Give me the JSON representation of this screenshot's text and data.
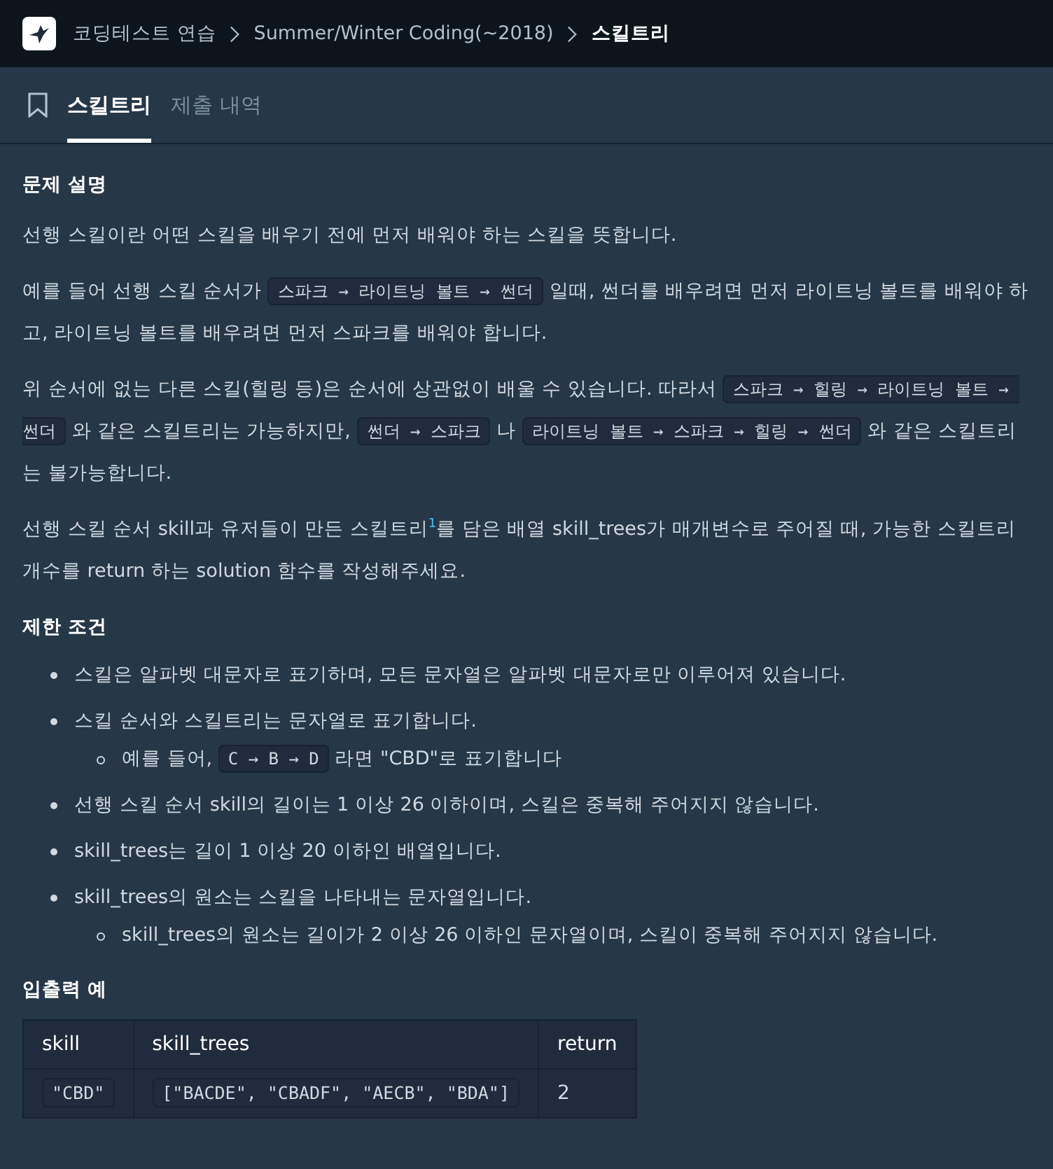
{
  "breadcrumb": [
    {
      "label": "코딩테스트 연습",
      "current": false
    },
    {
      "label": "Summer/Winter Coding(~2018)",
      "current": false
    },
    {
      "label": "스킬트리",
      "current": true
    }
  ],
  "tabs": [
    {
      "label": "스킬트리",
      "selected": true
    },
    {
      "label": "제출 내역",
      "selected": false
    }
  ],
  "sections": [
    {
      "heading": "문제 설명",
      "paragraphs": [
        [
          {
            "kind": "text",
            "text": "선행 스킬이란 어떤 스킬을 배우기 전에 먼저 배워야 하는 스킬을 뜻합니다."
          }
        ],
        [
          {
            "kind": "text",
            "text": "예를 들어 선행 스킬 순서가 "
          },
          {
            "kind": "code",
            "text": "스파크 → 라이트닝 볼트 → 썬더"
          },
          {
            "kind": "text",
            "text": " 일때, 썬더를 배우려면 먼저 라이트닝 볼트를 배워야 하고, 라이트닝 볼트를 배우려면 먼저 스파크를 배워야 합니다."
          }
        ],
        [
          {
            "kind": "text",
            "text": "위 순서에 없는 다른 스킬(힐링 등)은 순서에 상관없이 배울 수 있습니다. 따라서 "
          },
          {
            "kind": "code",
            "text": "스파크 → 힐링 → 라이트닝 볼트 → 썬더"
          },
          {
            "kind": "text",
            "text": " 와 같은 스킬트리는 가능하지만, "
          },
          {
            "kind": "code",
            "text": "썬더 → 스파크"
          },
          {
            "kind": "text",
            "text": " 나 "
          },
          {
            "kind": "code",
            "text": "라이트닝 볼트 → 스파크 → 힐링 → 썬더"
          },
          {
            "kind": "text",
            "text": " 와 같은 스킬트리는 불가능합니다."
          }
        ],
        [
          {
            "kind": "text",
            "text": "선행 스킬 순서 skill과 유저들이 만든 스킬트리"
          },
          {
            "kind": "sup",
            "text": "1"
          },
          {
            "kind": "text",
            "text": "를 담은 배열 skill_trees가 매개변수로 주어질 때, 가능한 스킬트리 개수를 return 하는 solution 함수를 작성해주세요."
          }
        ]
      ]
    },
    {
      "heading": "제한 조건",
      "list": [
        {
          "parts": [
            {
              "kind": "text",
              "text": "스킬은 알파벳 대문자로 표기하며, 모든 문자열은 알파벳 대문자로만 이루어져 있습니다."
            }
          ]
        },
        {
          "parts": [
            {
              "kind": "text",
              "text": "스킬 순서와 스킬트리는 문자열로 표기합니다."
            }
          ],
          "children": [
            {
              "parts": [
                {
                  "kind": "text",
                  "text": "예를 들어, "
                },
                {
                  "kind": "code",
                  "text": "C → B → D"
                },
                {
                  "kind": "text",
                  "text": " 라면 \"CBD\"로 표기합니다"
                }
              ]
            }
          ]
        },
        {
          "parts": [
            {
              "kind": "text",
              "text": "선행 스킬 순서 skill의 길이는 1 이상 26 이하이며, 스킬은 중복해 주어지지 않습니다."
            }
          ]
        },
        {
          "parts": [
            {
              "kind": "text",
              "text": "skill_trees는 길이 1 이상 20 이하인 배열입니다."
            }
          ]
        },
        {
          "parts": [
            {
              "kind": "text",
              "text": "skill_trees의 원소는 스킬을 나타내는 문자열입니다."
            }
          ],
          "children": [
            {
              "parts": [
                {
                  "kind": "text",
                  "text": "skill_trees의 원소는 길이가 2 이상 26 이하인 문자열이며, 스킬이 중복해 주어지지 않습니다."
                }
              ]
            }
          ]
        }
      ]
    },
    {
      "heading": "입출력 예",
      "table": {
        "columns": [
          "skill",
          "skill_trees",
          "return"
        ],
        "rows": [
          [
            {
              "kind": "code",
              "text": "\"CBD\""
            },
            {
              "kind": "code",
              "text": "[\"BACDE\", \"CBADF\", \"AECB\", \"BDA\"]"
            },
            {
              "kind": "text",
              "text": "2"
            }
          ]
        ]
      }
    }
  ]
}
